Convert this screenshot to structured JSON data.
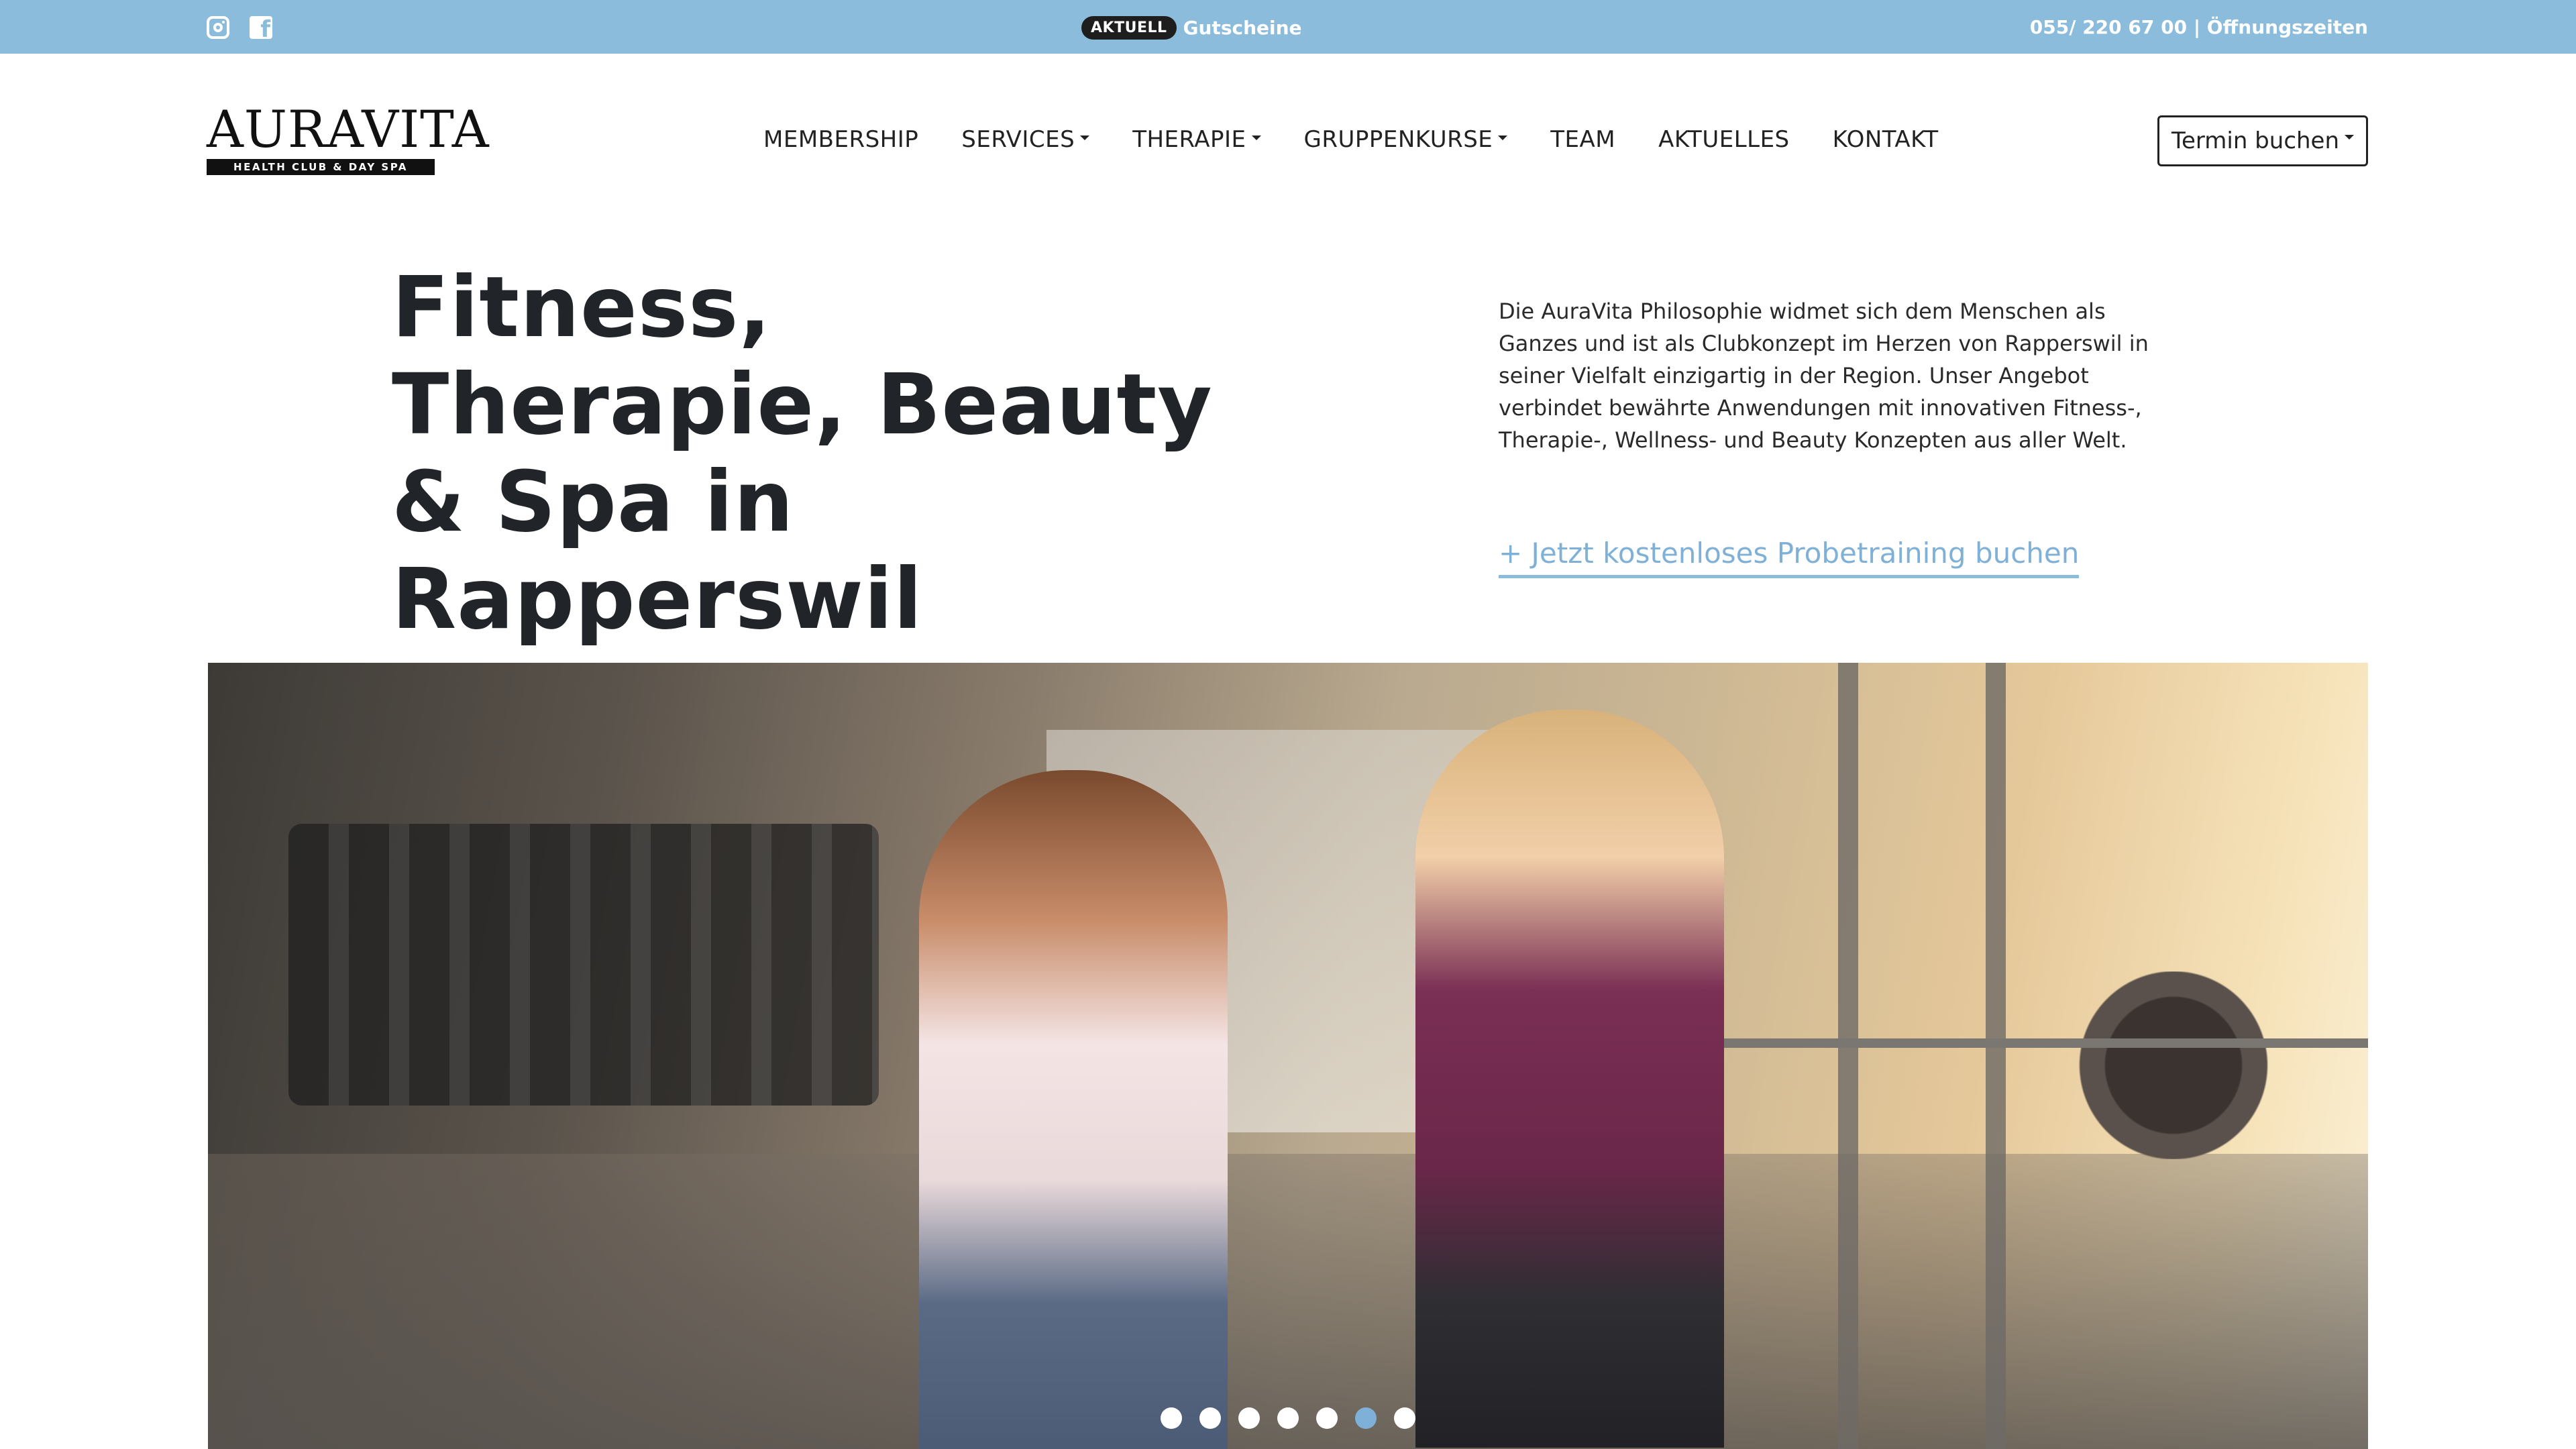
{
  "topbar": {
    "badge": "AKTUELL",
    "vouchers": "Gutscheine",
    "contact": "055/ 220 67 00 | Öffnungszeiten",
    "social": [
      "instagram-icon",
      "facebook-icon"
    ]
  },
  "logo": {
    "word": "AURAVITA",
    "tagline": "HEALTH CLUB & DAY SPA"
  },
  "nav": {
    "items": [
      {
        "label": "MEMBERSHIP",
        "dropdown": false
      },
      {
        "label": "SERVICES",
        "dropdown": true
      },
      {
        "label": "THERAPIE",
        "dropdown": true
      },
      {
        "label": "GRUPPENKURSE",
        "dropdown": true
      },
      {
        "label": "TEAM",
        "dropdown": false
      },
      {
        "label": "AKTUELLES",
        "dropdown": false
      },
      {
        "label": "KONTAKT",
        "dropdown": false
      }
    ],
    "book_button": "Termin buchen"
  },
  "hero": {
    "headline": "Fitness, Therapie, Beauty & Spa in Rapperswil",
    "intro": "Die AuraVita Philosophie widmet sich dem Menschen als Ganzes und ist als Clubkonzept im Herzen von Rapperswil in seiner Vielfalt einzigartig in der Region. Unser Angebot verbindet bewährte Anwendungen mit innovativen Fitness-, Therapie-, Wellness- und Beauty Konzepten aus aller Welt.",
    "cta": "+ Jetzt kostenloses Probetraining buchen"
  },
  "slider": {
    "slide_count": 7,
    "active_index": 5
  },
  "colors": {
    "topbar": "#8bbcdc",
    "accent": "#7fb1d8",
    "text": "#212529"
  }
}
